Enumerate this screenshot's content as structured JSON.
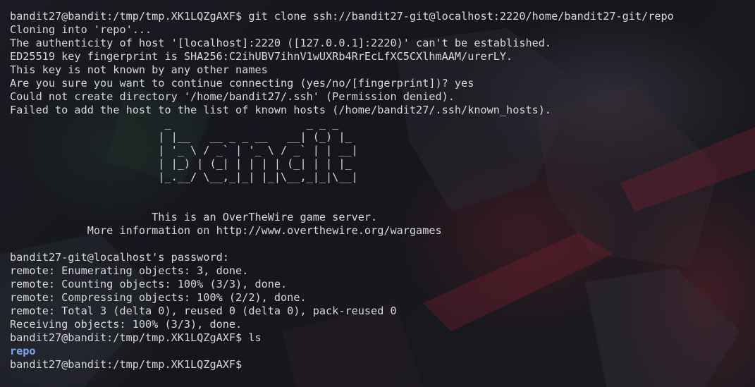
{
  "terminal": {
    "lines": [
      {
        "text": "bandit27@bandit:/tmp/tmp.XK1LQZgAXF$ git clone ssh://bandit27-git@localhost:2220/home/bandit27-git/repo"
      },
      {
        "text": "Cloning into 'repo'..."
      },
      {
        "text": "The authenticity of host '[localhost]:2220 ([127.0.0.1]:2220)' can't be established."
      },
      {
        "text": "ED25519 key fingerprint is SHA256:C2ihUBV7ihnV1wUXRb4RrEcLfXC5CXlhmAAM/urerLY."
      },
      {
        "text": "This key is not known by any other names"
      },
      {
        "text": "Are you sure you want to continue connecting (yes/no/[fingerprint])? yes"
      },
      {
        "text": "Could not create directory '/home/bandit27/.ssh' (Permission denied)."
      },
      {
        "text": "Failed to add the host to the list of known hosts (/home/bandit27/.ssh/known_hosts)."
      },
      {
        "text": "                        _                     _ _ _   "
      },
      {
        "text": "                       | |__   __ _ _ __   __| (_) |_ "
      },
      {
        "text": "                       | '_ \\ / _` | '_ \\ / _` | | __|"
      },
      {
        "text": "                       | |_) | (_| | | | | (_| | | |_ "
      },
      {
        "text": "                       |_.__/ \\__,_|_| |_|\\__,_|_|\\__|"
      },
      {
        "text": ""
      },
      {
        "text": ""
      },
      {
        "text": "                      This is an OverTheWire game server."
      },
      {
        "text": "            More information on http://www.overthewire.org/wargames"
      },
      {
        "text": ""
      },
      {
        "text": "bandit27-git@localhost's password:"
      },
      {
        "text": "remote: Enumerating objects: 3, done."
      },
      {
        "text": "remote: Counting objects: 100% (3/3), done."
      },
      {
        "text": "remote: Compressing objects: 100% (2/2), done."
      },
      {
        "text": "remote: Total 3 (delta 0), reused 0 (delta 0), pack-reused 0"
      },
      {
        "text": "Receiving objects: 100% (3/3), done."
      },
      {
        "text": "bandit27@bandit:/tmp/tmp.XK1LQZgAXF$ ls"
      },
      {
        "text": "repo",
        "kind": "directory"
      },
      {
        "text": "bandit27@bandit:/tmp/tmp.XK1LQZgAXF$ "
      }
    ]
  },
  "colors": {
    "foreground": "#d7d8dc",
    "directory": "#7aa6f3",
    "background": "#14151b"
  }
}
